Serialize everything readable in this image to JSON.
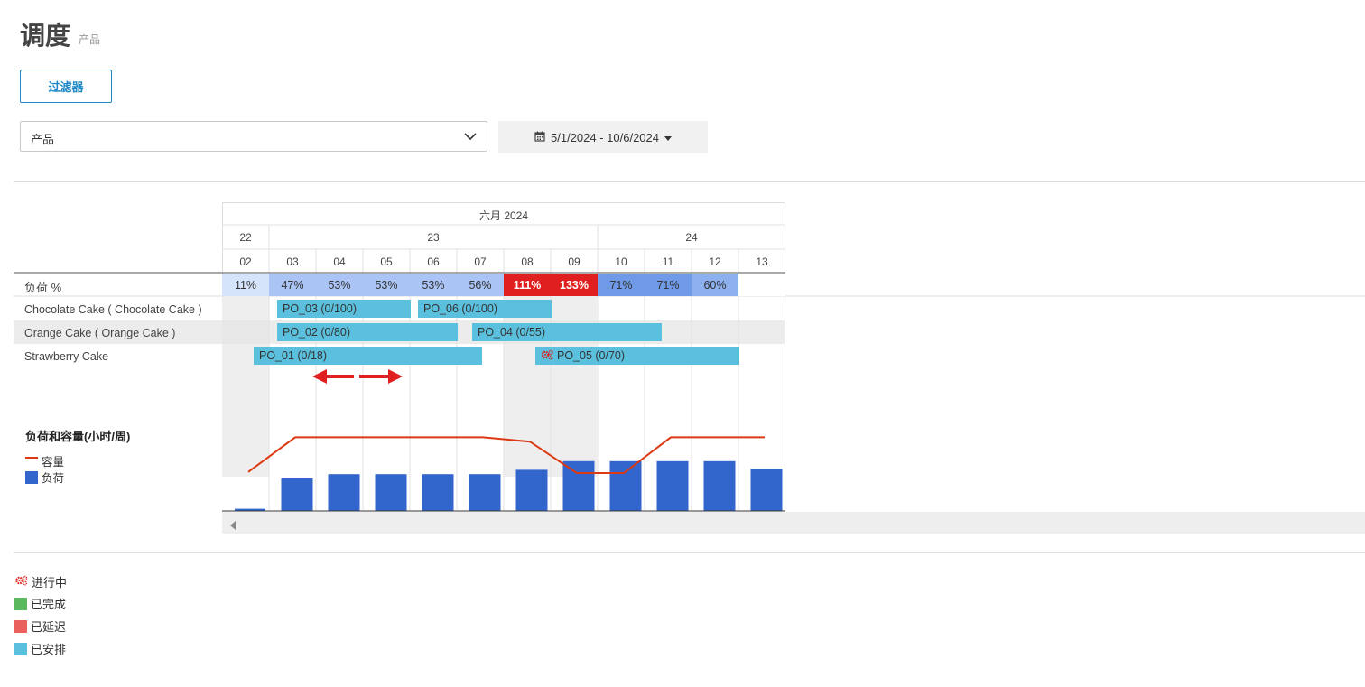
{
  "header": {
    "title": "调度",
    "subtitle": "产品"
  },
  "toolbar": {
    "filter_label": "过滤器"
  },
  "product_select": {
    "value": "产品"
  },
  "date_range": {
    "label": "5/1/2024 - 10/6/2024"
  },
  "timeline": {
    "month": "六月 2024",
    "weeks": [
      "22",
      "23",
      "24"
    ],
    "days": [
      "02",
      "03",
      "04",
      "05",
      "06",
      "07",
      "08",
      "09",
      "10",
      "11",
      "12",
      "13"
    ]
  },
  "load_row": {
    "label": "负荷 %",
    "values": [
      "11%",
      "47%",
      "53%",
      "53%",
      "53%",
      "56%",
      "111%",
      "133%",
      "71%",
      "71%",
      "60%",
      ""
    ],
    "colors": [
      "#d6e4fb",
      "#a9c4f5",
      "#a9c4f5",
      "#a9c4f5",
      "#a9c4f5",
      "#a9c4f5",
      "#e02020",
      "#e02020",
      "#6f9ae8",
      "#6f9ae8",
      "#8db0ef",
      "#ffffff"
    ]
  },
  "rows": [
    "Chocolate Cake ( Chocolate Cake )",
    "Orange Cake ( Orange Cake )",
    "Strawberry Cake"
  ],
  "orders": [
    "PO_03 (0/100)",
    "PO_06 (0/100)",
    "PO_02 (0/80)",
    "PO_04 (0/55)",
    "PO_01 (0/18)",
    "PO_05 (0/70)"
  ],
  "chart": {
    "title": "负荷和容量(小时/周)",
    "legend_capacity": "容量",
    "legend_load": "负荷"
  },
  "chart_data": {
    "type": "bar",
    "categories": [
      "02",
      "03",
      "04",
      "05",
      "06",
      "07",
      "08",
      "09",
      "10",
      "11",
      "12",
      "13"
    ],
    "series": [
      {
        "name": "负荷",
        "type": "bar",
        "values": [
          2,
          30,
          34,
          34,
          34,
          34,
          38,
          46,
          46,
          46,
          46,
          39
        ],
        "color": "#3366cc"
      },
      {
        "name": "容量",
        "type": "line",
        "values": [
          36,
          68,
          68,
          68,
          68,
          68,
          64,
          35,
          35,
          68,
          68,
          68
        ],
        "color": "#dc3912"
      }
    ],
    "title": "负荷和容量(小时/周)",
    "ylim": [
      0,
      80
    ]
  },
  "status_legend": [
    {
      "label": "进行中",
      "icon": "gears-icon",
      "color": "#e02020"
    },
    {
      "label": "已完成",
      "color": "#5cb85c"
    },
    {
      "label": "已延迟",
      "color": "#e9605c"
    },
    {
      "label": "已安排",
      "color": "#5bc0de"
    }
  ]
}
